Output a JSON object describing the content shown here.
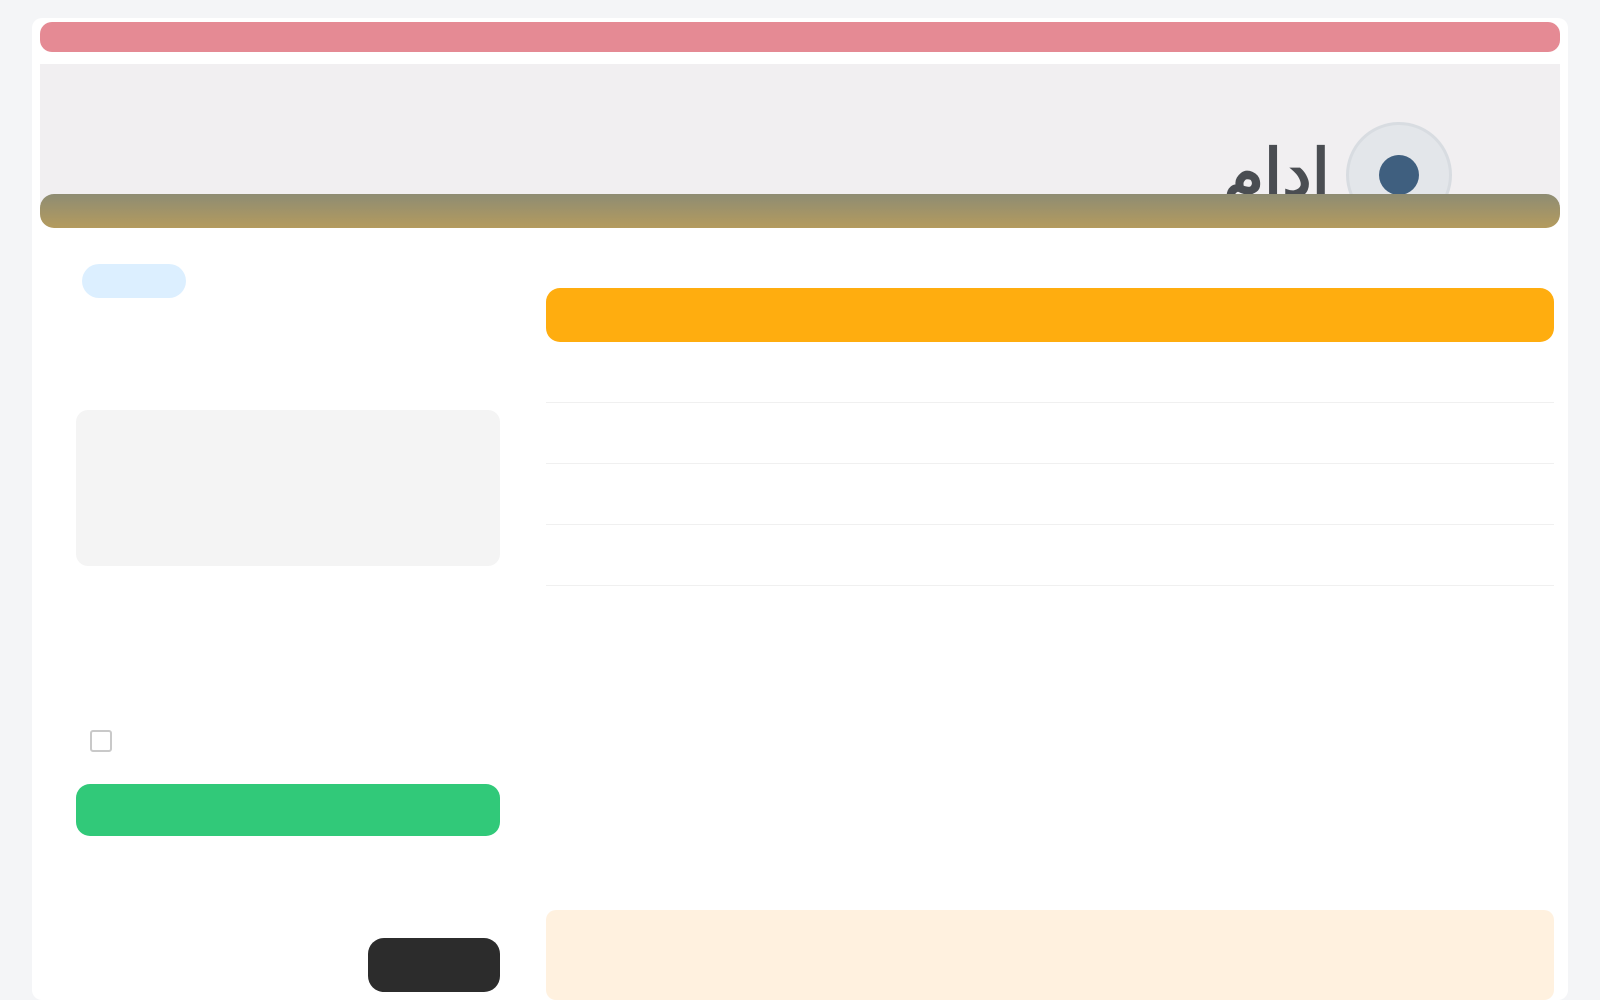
{
  "brand": {
    "title": "ادام",
    "logo_icon": "emblem-icon"
  },
  "colors": {
    "top_strip": "#e58a94",
    "gold_strip": "#b49b5e",
    "table_header": "#ffad0f",
    "pay_button": "#31c979",
    "pill": "#3a90e0"
  },
  "page_section_title": "",
  "table": {
    "headers": {
      "idx": "",
      "name": "",
      "price": "",
      "qty": "",
      "total": ""
    },
    "rows": [
      {
        "idx": "",
        "name": "",
        "price": "",
        "qty": "",
        "total": ""
      },
      {
        "idx": "",
        "name": "",
        "price": "",
        "qty": "",
        "total": ""
      },
      {
        "idx": "",
        "name": "",
        "price": "",
        "qty": "",
        "total": ""
      },
      {
        "idx": "",
        "name": "",
        "price": "",
        "qty": "",
        "total": ""
      }
    ]
  },
  "note": {
    "title": "",
    "text": ""
  },
  "summary": {
    "status_pill": "",
    "customer_name": "",
    "customer_sub": "",
    "customer_phone": "",
    "total_label": "",
    "total_amount": "",
    "total_currency": "",
    "meta_left_1": "",
    "meta_left_2": "",
    "meta_right_1": "",
    "meta_right_2": "",
    "meta_right_3": "",
    "checkbox_label": "",
    "pay_button": "",
    "disclaimer": "",
    "secondary_button": ""
  }
}
